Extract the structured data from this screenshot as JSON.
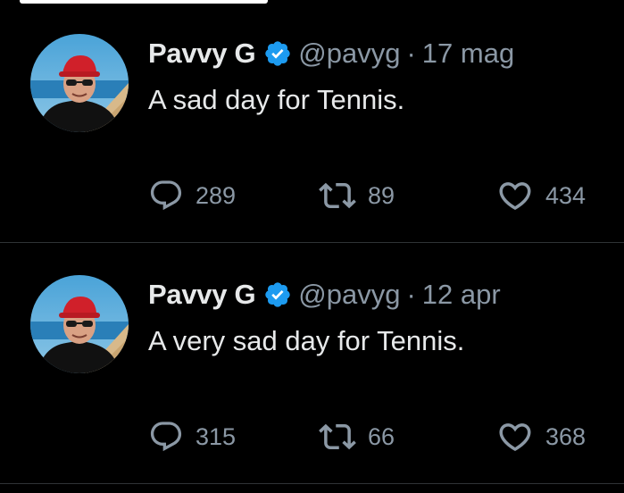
{
  "colors": {
    "background": "#000000",
    "primary_text": "#e7e9ea",
    "secondary_text": "#8b98a5",
    "divider": "#2f3336",
    "verified_badge": "#1d9bf0"
  },
  "tweets": [
    {
      "author": {
        "name": "Pavvy G",
        "handle": "@pavyg",
        "verified": true,
        "verified_icon": "verified-badge-icon",
        "avatar": "avatar"
      },
      "separator": "·",
      "date": "17 mag",
      "text": "A sad day for Tennis.",
      "actions": {
        "replies": "289",
        "retweets": "89",
        "likes": "434"
      }
    },
    {
      "author": {
        "name": "Pavvy G",
        "handle": "@pavyg",
        "verified": true,
        "verified_icon": "verified-badge-icon",
        "avatar": "avatar"
      },
      "separator": "·",
      "date": "12 apr",
      "text": "A very sad day for Tennis.",
      "actions": {
        "replies": "315",
        "retweets": "66",
        "likes": "368"
      }
    }
  ]
}
